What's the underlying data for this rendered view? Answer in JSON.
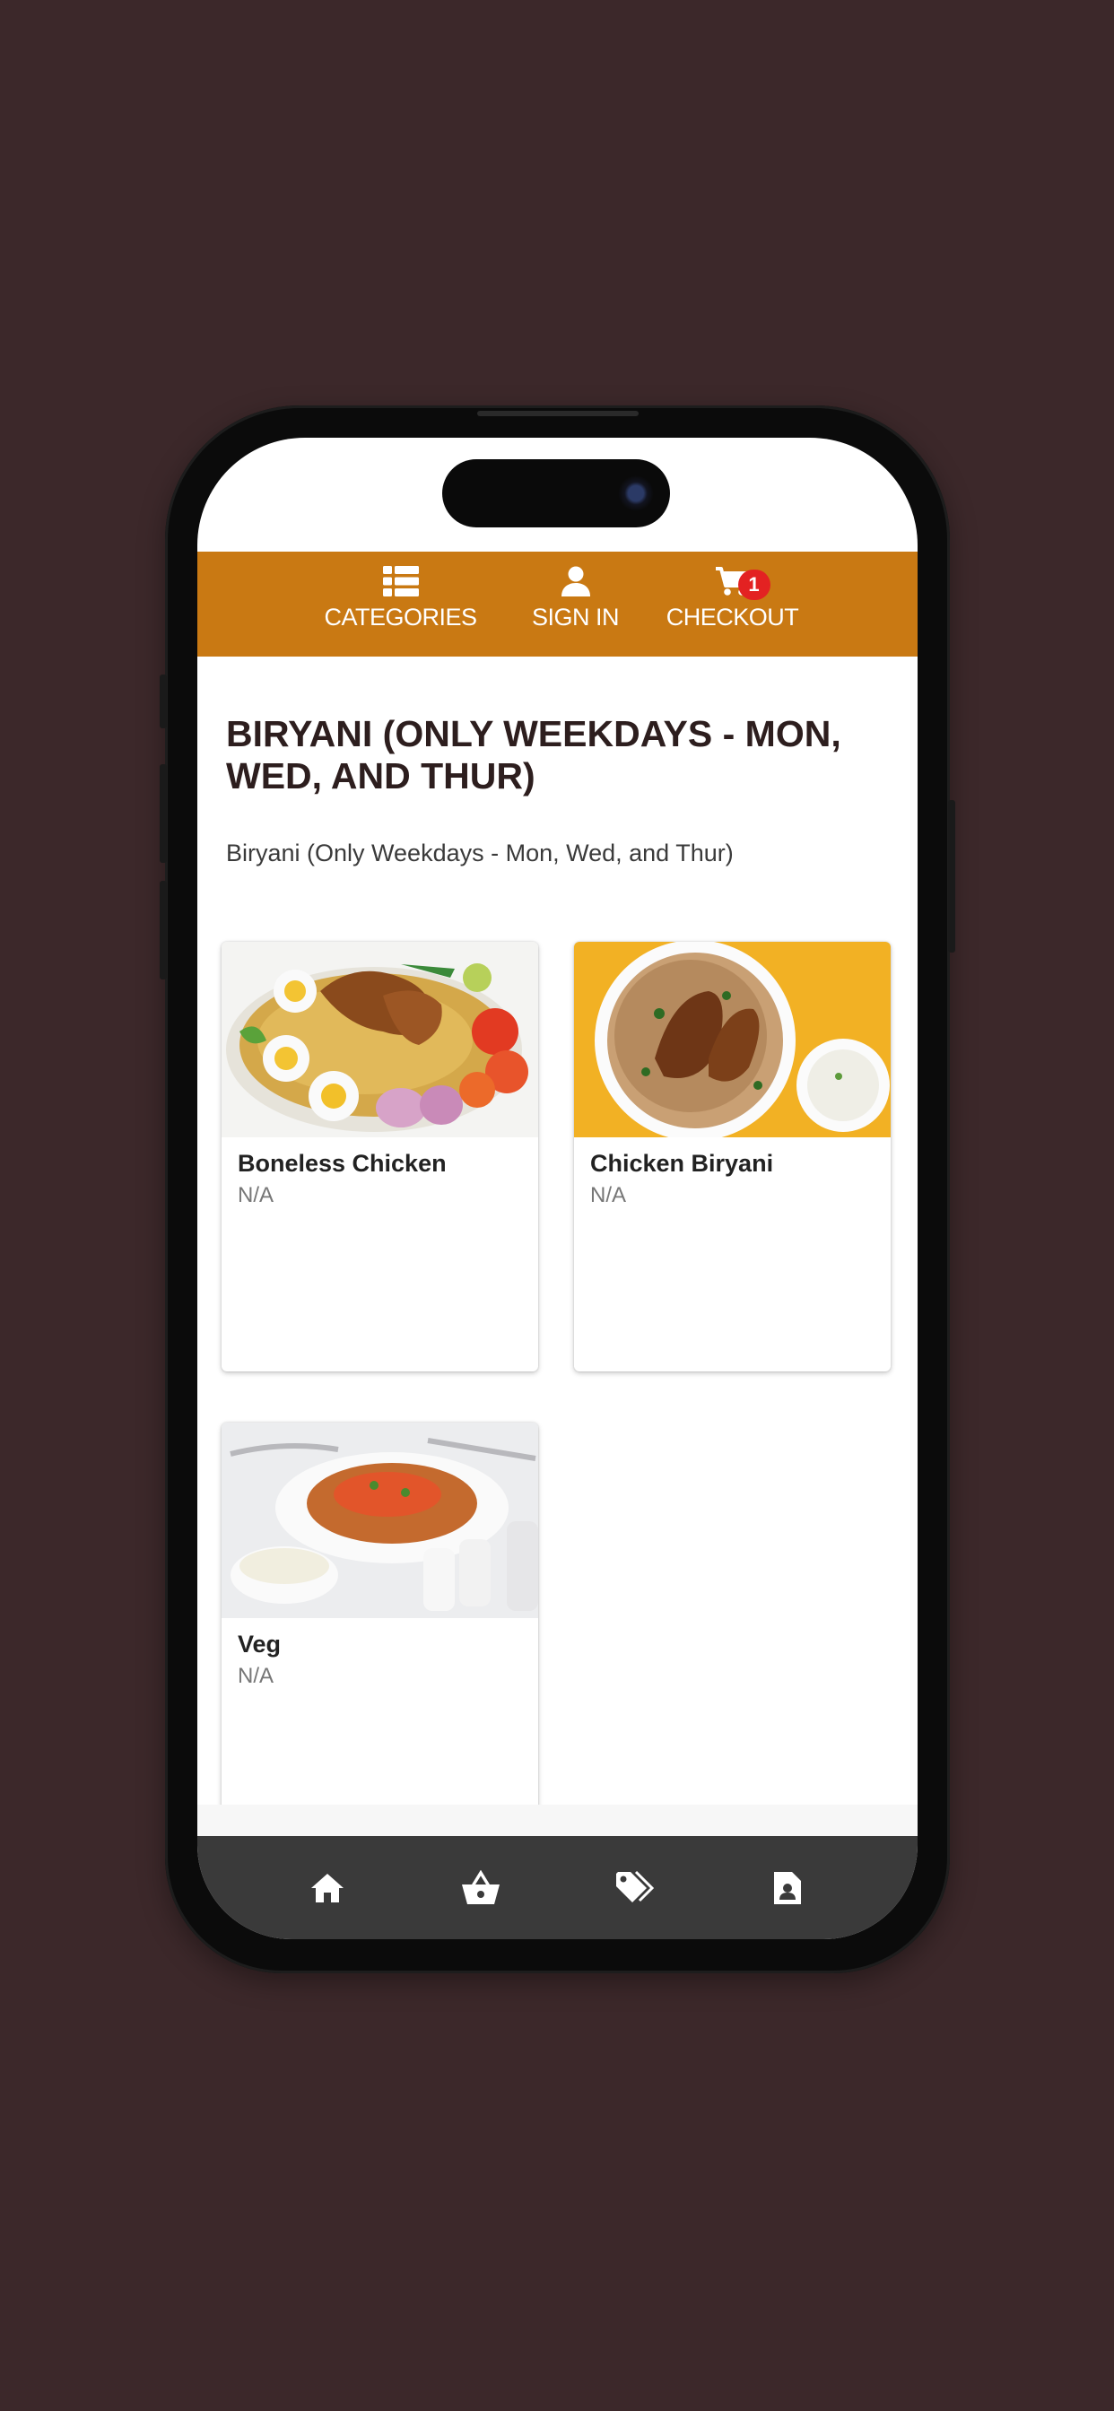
{
  "header": {
    "nav": [
      {
        "label": "CATEGORIES",
        "icon": "list-icon"
      },
      {
        "label": "SIGN IN",
        "icon": "user-icon"
      },
      {
        "label": "CHECKOUT",
        "icon": "cart-icon"
      }
    ],
    "cart_count": "1",
    "accent_color": "#c97913"
  },
  "main": {
    "title": "BIRYANI (ONLY WEEKDAYS - MON, WED, AND THUR)",
    "subtitle": "Biryani (Only Weekdays - Mon, Wed, and Thur)",
    "items": [
      {
        "name": "Boneless Chicken",
        "price": "N/A"
      },
      {
        "name": "Chicken Biryani",
        "price": "N/A"
      },
      {
        "name": "Veg",
        "price": "N/A"
      }
    ]
  },
  "tabbar": {
    "tabs": [
      "home-icon",
      "basket-icon",
      "tag-icon",
      "contact-icon"
    ]
  }
}
